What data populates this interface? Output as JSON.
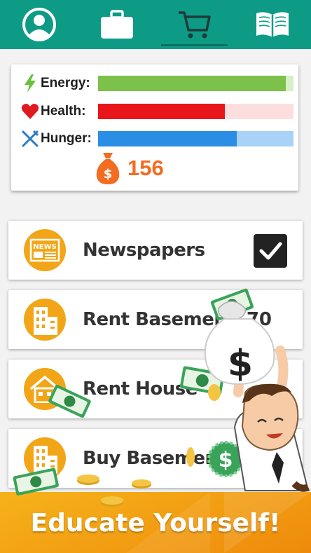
{
  "nav": {
    "tabs": [
      {
        "icon": "profile-icon",
        "active": false
      },
      {
        "icon": "briefcase-icon",
        "active": false
      },
      {
        "icon": "cart-icon",
        "active": true
      },
      {
        "icon": "book-icon",
        "active": false
      }
    ]
  },
  "stats": {
    "energy": {
      "label": "Energy:",
      "icon": "lightning-icon",
      "level": 0.96,
      "color": "#7cc14a",
      "track": "#d7f0c6"
    },
    "health": {
      "label": "Health:",
      "icon": "heart-icon",
      "level": 0.65,
      "color": "#e8161a",
      "track": "#fddede"
    },
    "hunger": {
      "label": "Hunger:",
      "icon": "fork-knife-icon",
      "level": 0.71,
      "color": "#2b8ee5",
      "track": "#a8d2f8"
    },
    "money": "156"
  },
  "items": [
    {
      "title": "Newspapers",
      "icon": "newspaper-icon",
      "checked": true
    },
    {
      "title": "Rent Basement",
      "price": "70",
      "icon": "building-icon"
    },
    {
      "title": "Rent House",
      "icon": "house-icon"
    },
    {
      "title": "Buy Basement",
      "icon": "building-icon"
    }
  ],
  "banner": {
    "text": "Educate Yourself!"
  },
  "colors": {
    "nav": "#0d9b86",
    "accent": "#f2a516",
    "money": "#f26d21"
  }
}
